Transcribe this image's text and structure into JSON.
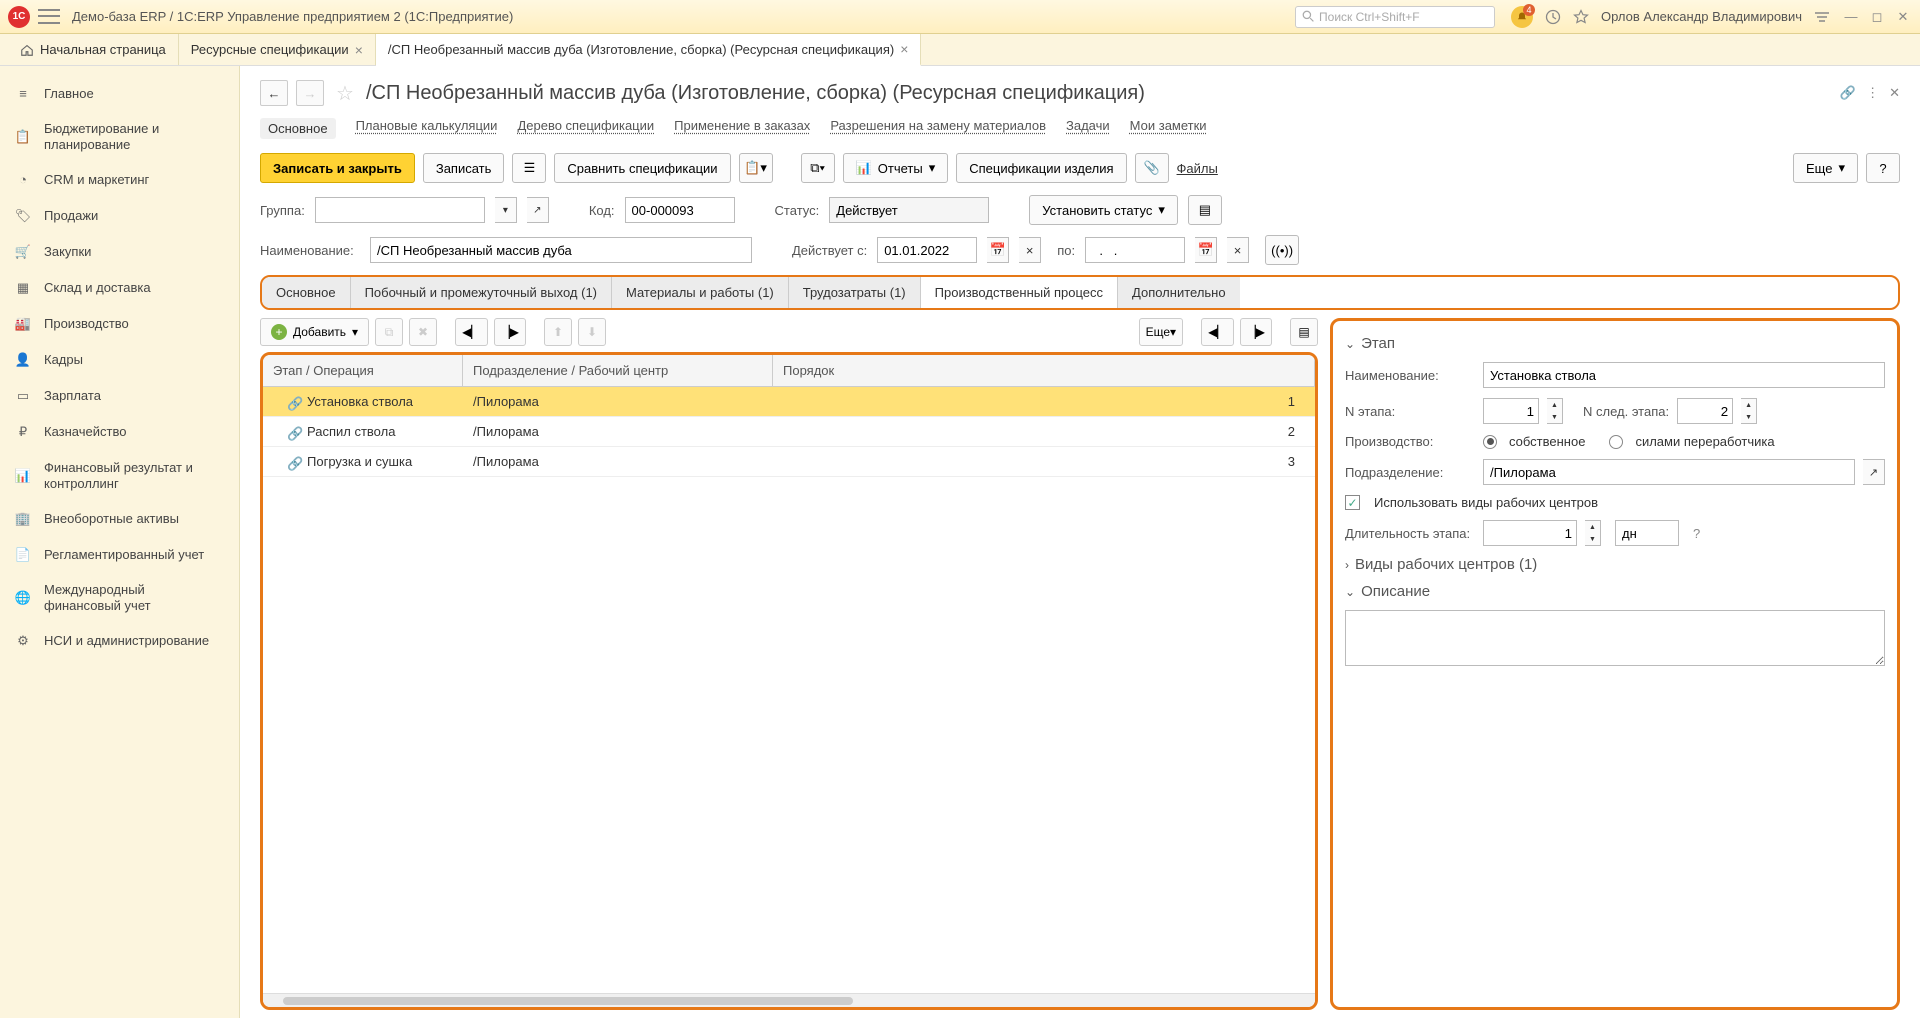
{
  "topbar": {
    "app_title": "Демо-база ERP / 1С:ERP Управление предприятием 2  (1С:Предприятие)",
    "search_placeholder": "Поиск Ctrl+Shift+F",
    "username": "Орлов Александр Владимирович",
    "bell_count": "4"
  },
  "tabs": {
    "home": "Начальная страница",
    "t1": "Ресурсные спецификации",
    "t2": "/СП Необрезанный массив дуба (Изготовление, сборка) (Ресурсная спецификация)"
  },
  "sidebar": {
    "items": [
      "Главное",
      "Бюджетирование и планирование",
      "CRM и маркетинг",
      "Продажи",
      "Закупки",
      "Склад и доставка",
      "Производство",
      "Кадры",
      "Зарплата",
      "Казначейство",
      "Финансовый результат и контроллинг",
      "Внеоборотные активы",
      "Регламентированный учет",
      "Международный финансовый учет",
      "НСИ и администрирование"
    ]
  },
  "page": {
    "title": "/СП Необрезанный массив дуба (Изготовление, сборка) (Ресурсная спецификация)"
  },
  "navlinks": {
    "l0": "Основное",
    "l1": "Плановые калькуляции",
    "l2": "Дерево спецификации",
    "l3": "Применение в заказах",
    "l4": "Разрешения на замену материалов",
    "l5": "Задачи",
    "l6": "Мои заметки"
  },
  "toolbar": {
    "save_close": "Записать и закрыть",
    "save": "Записать",
    "compare": "Сравнить спецификации",
    "reports": "Отчеты",
    "spec_items": "Спецификации изделия",
    "files": "Файлы",
    "more": "Еще",
    "help": "?"
  },
  "form": {
    "group_label": "Группа:",
    "group_value": "",
    "code_label": "Код:",
    "code_value": "00-000093",
    "status_label": "Статус:",
    "status_value": "Действует",
    "set_status": "Установить статус",
    "name_label": "Наименование:",
    "name_value": "/СП Необрезанный массив дуба",
    "valid_from_label": "Действует с:",
    "valid_from_value": "01.01.2022",
    "to_label": "по:",
    "to_value": "  .   .   "
  },
  "itabs": {
    "t0": "Основное",
    "t1": "Побочный и промежуточный выход (1)",
    "t2": "Материалы и работы (1)",
    "t3": "Трудозатраты (1)",
    "t4": "Производственный процесс",
    "t5": "Дополнительно"
  },
  "leftbar": {
    "add": "Добавить",
    "more": "Еще"
  },
  "table": {
    "h1": "Этап / Операция",
    "h2": "Подразделение / Рабочий центр",
    "h3": "Порядок",
    "rows": [
      {
        "op": "Установка ствола",
        "dept": "/Пилорама",
        "ord": "1"
      },
      {
        "op": "Распил ствола",
        "dept": "/Пилорама",
        "ord": "2"
      },
      {
        "op": "Погрузка и сушка",
        "dept": "/Пилорама",
        "ord": "3"
      }
    ]
  },
  "stage": {
    "section": "Этап",
    "name_label": "Наименование:",
    "name_value": "Установка ствола",
    "n_label": "N этапа:",
    "n_value": "1",
    "next_label": "N след. этапа:",
    "next_value": "2",
    "prod_label": "Производство:",
    "prod_own": "собственное",
    "prod_ext": "силами переработчика",
    "dept_label": "Подразделение:",
    "dept_value": "/Пилорама",
    "use_wc": "Использовать виды рабочих центров",
    "dur_label": "Длительность этапа:",
    "dur_value": "1",
    "dur_unit": "дн",
    "wc_section": "Виды рабочих центров (1)",
    "desc_section": "Описание"
  }
}
